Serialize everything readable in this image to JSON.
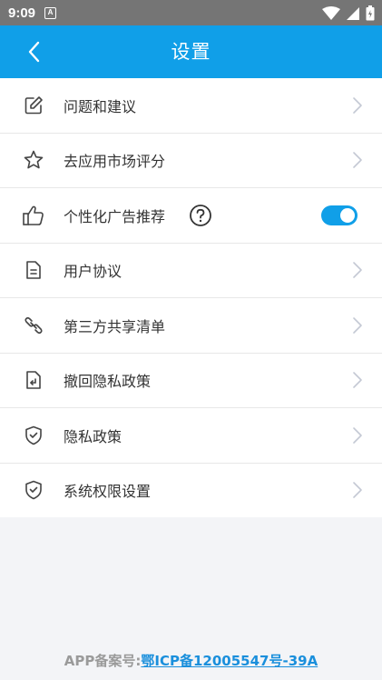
{
  "status_bar": {
    "time": "9:09",
    "notification_glyph": "A",
    "icons": [
      "wifi-icon",
      "signal-icon",
      "battery-icon"
    ]
  },
  "app_bar": {
    "title": "设置",
    "back_icon": "chevron-left-icon"
  },
  "settings": [
    {
      "label": "问题和建议",
      "icon": "edit-icon"
    },
    {
      "label": "去应用市场评分",
      "icon": "star-icon"
    },
    {
      "label": "个性化广告推荐",
      "icon": "thumbs-up-icon",
      "help_icon": "help-circle-icon",
      "toggle_on": true
    },
    {
      "label": "用户协议",
      "icon": "document-icon"
    },
    {
      "label": "第三方共享清单",
      "icon": "link-icon"
    },
    {
      "label": "撤回隐私政策",
      "icon": "revoke-document-icon"
    },
    {
      "label": "隐私政策",
      "icon": "shield-check-icon"
    },
    {
      "label": "系统权限设置",
      "icon": "shield-check-icon"
    }
  ],
  "footer": {
    "prefix": "APP备案号:",
    "icp_number": "鄂ICP备12005547号-39A"
  },
  "colors": {
    "accent": "#109fe8",
    "status_bar": "#757575",
    "background": "#f3f4f7",
    "link": "#1a8fdc"
  }
}
